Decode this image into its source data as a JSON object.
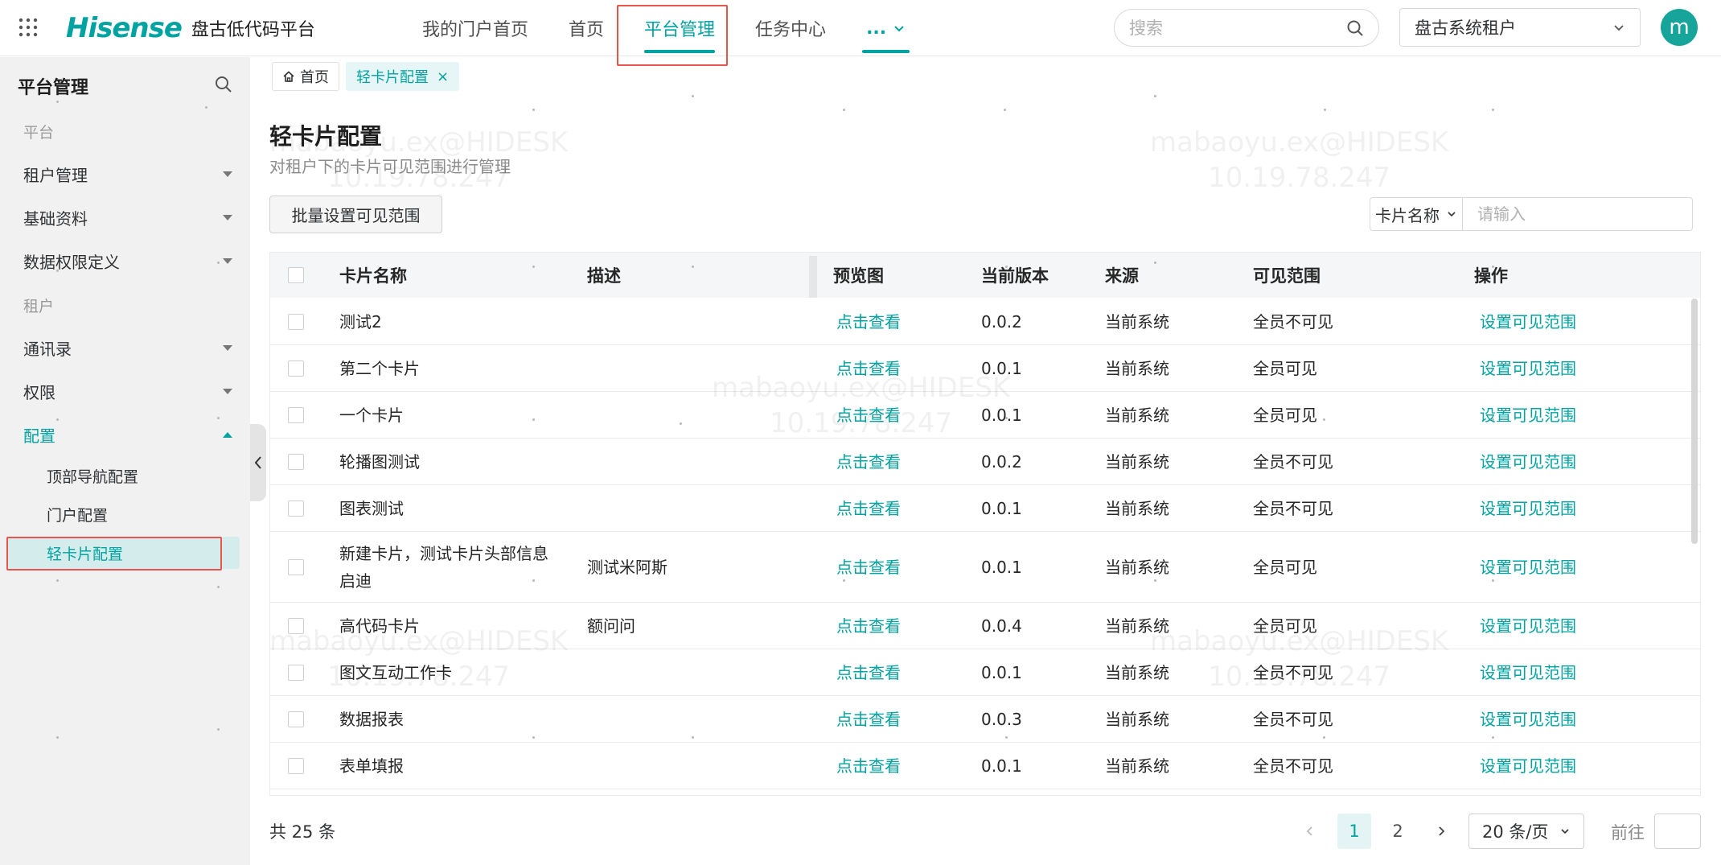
{
  "header": {
    "brand_logo": "Hisense",
    "brand_name": "盘古低代码平台",
    "nav": [
      "我的门户首页",
      "首页",
      "平台管理",
      "任务中心"
    ],
    "nav_more": "...",
    "search_placeholder": "搜索",
    "tenant": "盘古系统租户",
    "avatar_letter": "m"
  },
  "sidebar": {
    "title": "平台管理",
    "group_platform": "平台",
    "items_platform": [
      "租户管理",
      "基础资料",
      "数据权限定义"
    ],
    "group_tenant": "租户",
    "items_tenant": [
      "通讯录",
      "权限",
      "配置"
    ],
    "sub_config": [
      "顶部导航配置",
      "门户配置",
      "轻卡片配置"
    ]
  },
  "tabs": {
    "home": "首页",
    "current": "轻卡片配置",
    "close": "×"
  },
  "page": {
    "title": "轻卡片配置",
    "description": "对租户下的卡片可见范围进行管理",
    "batch_button": "批量设置可见范围",
    "filter_field": "卡片名称",
    "filter_placeholder": "请输入"
  },
  "table": {
    "columns": [
      "卡片名称",
      "描述",
      "预览图",
      "当前版本",
      "来源",
      "可见范围",
      "操作"
    ],
    "rows": [
      {
        "name": "测试2",
        "desc": "",
        "preview": "点击查看",
        "version": "0.0.2",
        "source": "当前系统",
        "scope": "全员不可见",
        "action": "设置可见范围"
      },
      {
        "name": "第二个卡片",
        "desc": "",
        "preview": "点击查看",
        "version": "0.0.1",
        "source": "当前系统",
        "scope": "全员可见",
        "action": "设置可见范围"
      },
      {
        "name": "一个卡片",
        "desc": "",
        "preview": "点击查看",
        "version": "0.0.1",
        "source": "当前系统",
        "scope": "全员可见",
        "action": "设置可见范围"
      },
      {
        "name": "轮播图测试",
        "desc": "",
        "preview": "点击查看",
        "version": "0.0.2",
        "source": "当前系统",
        "scope": "全员不可见",
        "action": "设置可见范围"
      },
      {
        "name": "图表测试",
        "desc": "",
        "preview": "点击查看",
        "version": "0.0.1",
        "source": "当前系统",
        "scope": "全员不可见",
        "action": "设置可见范围"
      },
      {
        "name": "新建卡片，测试卡片头部信息启迪",
        "desc": "测试米阿斯",
        "preview": "点击查看",
        "version": "0.0.1",
        "source": "当前系统",
        "scope": "全员可见",
        "action": "设置可见范围"
      },
      {
        "name": "高代码卡片",
        "desc": "额问问",
        "preview": "点击查看",
        "version": "0.0.4",
        "source": "当前系统",
        "scope": "全员可见",
        "action": "设置可见范围"
      },
      {
        "name": "图文互动工作卡",
        "desc": "",
        "preview": "点击查看",
        "version": "0.0.1",
        "source": "当前系统",
        "scope": "全员不可见",
        "action": "设置可见范围"
      },
      {
        "name": "数据报表",
        "desc": "",
        "preview": "点击查看",
        "version": "0.0.3",
        "source": "当前系统",
        "scope": "全员不可见",
        "action": "设置可见范围"
      },
      {
        "name": "表单填报",
        "desc": "",
        "preview": "点击查看",
        "version": "0.0.1",
        "source": "当前系统",
        "scope": "全员不可见",
        "action": "设置可见范围"
      }
    ]
  },
  "pagination": {
    "total": "共 25 条",
    "pages": [
      "1",
      "2"
    ],
    "current_page": "1",
    "page_size": "20 条/页",
    "goto_label": "前往"
  },
  "watermark": {
    "user": "mabaoyu.ex@HIDESK",
    "ip": "10.19.78.247"
  },
  "colors": {
    "accent": "#00a3a1",
    "highlight_box": "#e8554d",
    "sidebar_bg": "#f1f1f1"
  }
}
